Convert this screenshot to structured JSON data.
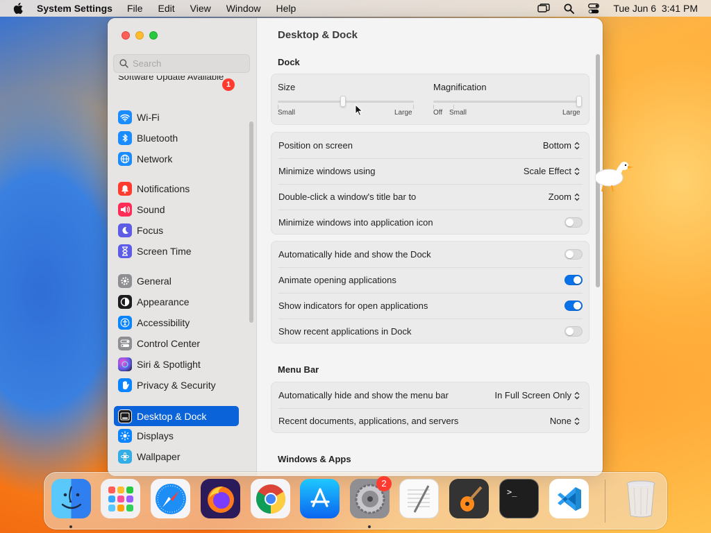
{
  "menubar": {
    "app_name": "System Settings",
    "menus": [
      "File",
      "Edit",
      "View",
      "Window",
      "Help"
    ],
    "datetime": "Tue Jun 6  3:41 PM",
    "icons": [
      "apple-icon",
      "screen-mirroring-icon",
      "spotlight-icon",
      "control-center-icon"
    ]
  },
  "window": {
    "search_placeholder": "Search",
    "software_update": {
      "label": "Software Update Available",
      "badge": "1"
    },
    "sidebar": [
      {
        "label": "Wi-Fi",
        "icon": "wifi-icon",
        "color": "#1a8cff"
      },
      {
        "label": "Bluetooth",
        "icon": "bluetooth-icon",
        "color": "#1a8cff"
      },
      {
        "label": "Network",
        "icon": "globe-icon",
        "color": "#1a8cff"
      },
      {
        "label": "Notifications",
        "icon": "bell-icon",
        "color": "#ff3b30"
      },
      {
        "label": "Sound",
        "icon": "speaker-icon",
        "color": "#ff2d55"
      },
      {
        "label": "Focus",
        "icon": "moon-icon",
        "color": "#5e5ce6"
      },
      {
        "label": "Screen Time",
        "icon": "hourglass-icon",
        "color": "#5e5ce6"
      },
      {
        "label": "General",
        "icon": "gear-icon",
        "color": "#8e8e93"
      },
      {
        "label": "Appearance",
        "icon": "appearance-icon",
        "color": "#1c1c1e"
      },
      {
        "label": "Accessibility",
        "icon": "accessibility-icon",
        "color": "#0a84ff"
      },
      {
        "label": "Control Center",
        "icon": "control-center-icon",
        "color": "#8e8e93"
      },
      {
        "label": "Siri & Spotlight",
        "icon": "siri-icon",
        "color": "#5e5ce6"
      },
      {
        "label": "Privacy & Security",
        "icon": "hand-icon",
        "color": "#0a84ff"
      },
      {
        "label": "Desktop & Dock",
        "icon": "dock-icon",
        "color": "#1c1c1e",
        "selected": true
      },
      {
        "label": "Displays",
        "icon": "sun-icon",
        "color": "#0a84ff"
      },
      {
        "label": "Wallpaper",
        "icon": "wallpaper-icon",
        "color": "#32ade6"
      }
    ]
  },
  "content": {
    "title": "Desktop & Dock",
    "dock_section": "Dock",
    "size": {
      "label": "Size",
      "min_label": "Small",
      "max_label": "Large",
      "value": 0.48
    },
    "magnification": {
      "label": "Magnification",
      "off_label": "Off",
      "min_label": "Small",
      "max_label": "Large",
      "value": 1.0
    },
    "popups": [
      {
        "label": "Position on screen",
        "value": "Bottom"
      },
      {
        "label": "Minimize windows using",
        "value": "Scale Effect"
      },
      {
        "label": "Double-click a window's title bar to",
        "value": "Zoom"
      }
    ],
    "minimize_into_icon": {
      "label": "Minimize windows into application icon",
      "on": false
    },
    "toggles": [
      {
        "label": "Automatically hide and show the Dock",
        "on": false
      },
      {
        "label": "Animate opening applications",
        "on": true
      },
      {
        "label": "Show indicators for open applications",
        "on": true
      },
      {
        "label": "Show recent applications in Dock",
        "on": false
      }
    ],
    "menubar_section": "Menu Bar",
    "menubar_rows": [
      {
        "label": "Automatically hide and show the menu bar",
        "value": "In Full Screen Only"
      },
      {
        "label": "Recent documents, applications, and servers",
        "value": "None"
      }
    ],
    "windows_section": "Windows & Apps"
  },
  "dock": {
    "apps": [
      {
        "name": "Finder",
        "icon": "finder-icon",
        "running": true
      },
      {
        "name": "Launchpad",
        "icon": "launchpad-icon",
        "running": false
      },
      {
        "name": "Safari",
        "icon": "safari-icon",
        "running": false
      },
      {
        "name": "Firefox",
        "icon": "firefox-icon",
        "running": false
      },
      {
        "name": "Chrome",
        "icon": "chrome-icon",
        "running": false
      },
      {
        "name": "App Store",
        "icon": "app-store-icon",
        "running": false
      },
      {
        "name": "System Settings",
        "icon": "system-settings-icon",
        "running": true,
        "badge": "2"
      },
      {
        "name": "TextEdit",
        "icon": "textedit-icon",
        "running": false
      },
      {
        "name": "GarageBand",
        "icon": "garageband-icon",
        "running": false
      },
      {
        "name": "Terminal",
        "icon": "terminal-icon",
        "running": false
      },
      {
        "name": "VS Code",
        "icon": "vscode-icon",
        "running": false
      },
      {
        "name": "Trash",
        "icon": "trash-icon",
        "running": false
      }
    ]
  }
}
